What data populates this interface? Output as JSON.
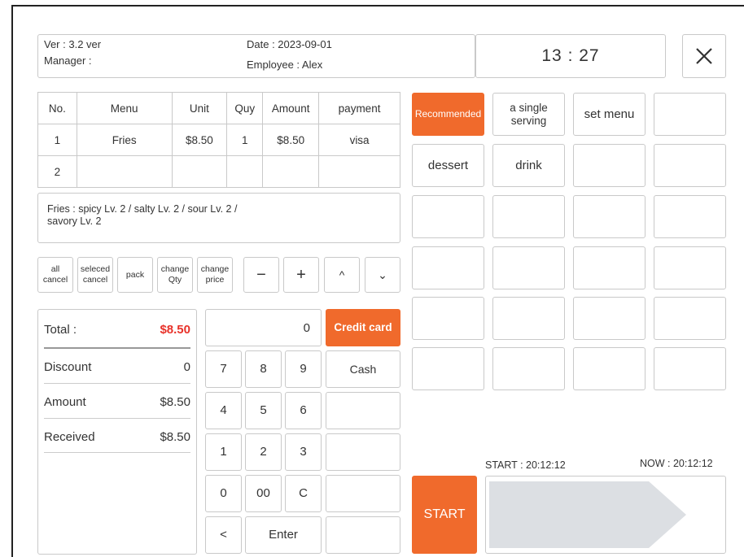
{
  "header": {
    "version": "Ver : 3.2 ver",
    "manager": "Manager :",
    "date": "Date : 2023-09-01",
    "employee": "Employee : Alex",
    "time": "13 : 27",
    "close_icon": "close-icon"
  },
  "order_table": {
    "columns": [
      "No.",
      "Menu",
      "Unit",
      "Quy",
      "Amount",
      "payment"
    ],
    "rows": [
      [
        "1",
        "Fries",
        "$8.50",
        "1",
        "$8.50",
        "visa"
      ],
      [
        "2",
        "",
        "",
        "",
        "",
        ""
      ]
    ]
  },
  "options_note": {
    "line1": "Fries : spicy Lv. 2 / salty Lv. 2 / sour Lv. 2 /",
    "line2": "savory Lv. 2"
  },
  "actions": {
    "all_cancel": [
      "all",
      "cancel"
    ],
    "selected_cancel": [
      "seleced",
      "cancel"
    ],
    "pack": "pack",
    "change_qty": [
      "change",
      "Qty"
    ],
    "change_price": [
      "change",
      "price"
    ],
    "minus": "−",
    "plus": "+",
    "up": "^",
    "down": "⌄"
  },
  "summary": {
    "total_label": "Total :",
    "total_value": "$8.50",
    "discount_label": "Discount",
    "discount_value": "0",
    "amount_label": "Amount",
    "amount_value": "$8.50",
    "received_label": "Received",
    "received_value": "$8.50"
  },
  "keypad": {
    "display": "0",
    "keys": [
      [
        "7",
        "8",
        "9"
      ],
      [
        "4",
        "5",
        "6"
      ],
      [
        "1",
        "2",
        "3"
      ],
      [
        "0",
        "00",
        "C"
      ]
    ],
    "back": "<",
    "enter": "Enter"
  },
  "payment": {
    "credit_card": "Credit card",
    "cash": "Cash"
  },
  "categories": {
    "recommended": "Recommended",
    "single_serving": [
      "a single",
      "serving"
    ],
    "set_menu": "set menu",
    "dessert": "dessert",
    "drink": "drink"
  },
  "timer": {
    "start_time": "START : 20:12:12",
    "now_time": "NOW : 20:12:12",
    "start_button": "START"
  },
  "colors": {
    "accent": "#f06a2c",
    "total_red": "#e8322a",
    "border": "#c9c9c9"
  }
}
